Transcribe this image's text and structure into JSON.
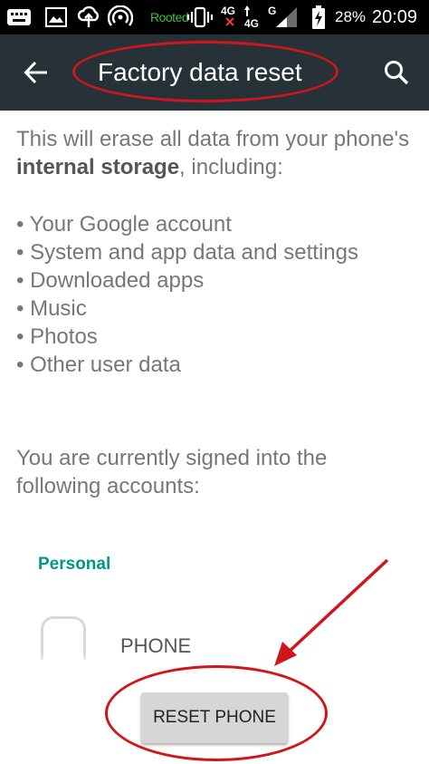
{
  "status_bar": {
    "rooted_label": "Rooted",
    "network_4g_top": "4G",
    "network_4g_bottom": "4G",
    "network_g": "G",
    "battery_percent": "28%",
    "time": "20:09",
    "rooted_color": "#3bbf3b"
  },
  "toolbar": {
    "title": "Factory data reset",
    "back_icon": "arrow-back-icon",
    "search_icon": "search-icon",
    "background": "#263238"
  },
  "content": {
    "intro_part1": "This will erase all data from your phone's ",
    "intro_bold": "internal storage",
    "intro_part2": ", including:",
    "bullets": [
      "• Your Google account",
      "• System and app data and settings",
      "• Downloaded apps",
      "• Music",
      "• Photos",
      "• Other user data"
    ],
    "signed_in_text": "You are currently signed into the following accounts:",
    "section_personal": "Personal",
    "account_name": "PHONE"
  },
  "actions": {
    "reset_label": "RESET PHONE"
  },
  "annotations": {
    "highlight_color": "#d0161c"
  }
}
